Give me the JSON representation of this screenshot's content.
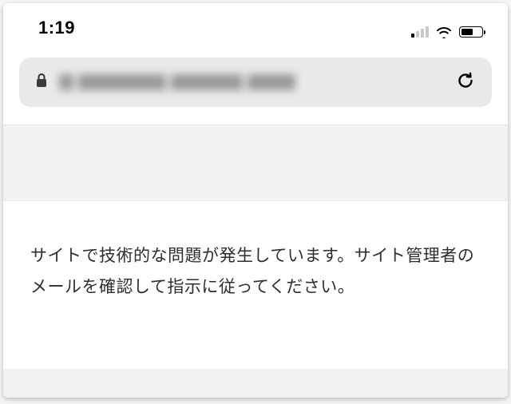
{
  "status_bar": {
    "time": "1:19",
    "cellular_bars_active": 1,
    "cellular_bars_total": 4,
    "battery_percent": 58
  },
  "address_bar": {
    "secure": true,
    "url_display": "(obscured)",
    "reload_label": "Reload"
  },
  "page": {
    "error_message": "サイトで技術的な問題が発生しています。サイト管理者のメールを確認して指示に従ってください。"
  }
}
